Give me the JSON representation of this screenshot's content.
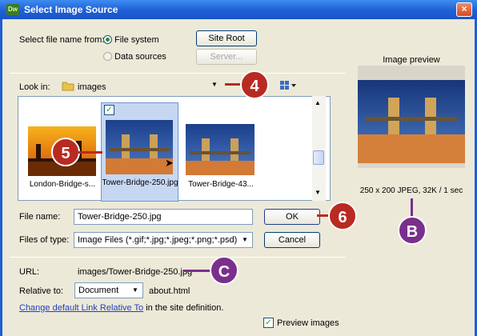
{
  "window": {
    "title": "Select Image Source",
    "app_icon": "Dw",
    "close_label": "×"
  },
  "select_from": {
    "label": "Select file name from:",
    "options": [
      {
        "label": "File system",
        "selected": true
      },
      {
        "label": "Data sources",
        "selected": false
      }
    ],
    "site_root_label": "Site Root",
    "server_label": "Server..."
  },
  "look_in": {
    "label": "Look in:",
    "value": "images",
    "view_icon": "thumbnails-view-icon"
  },
  "files": [
    {
      "name": "London-Bridge-s...",
      "selected": false
    },
    {
      "name": "Tower-Bridge-250.jpg",
      "selected": true
    },
    {
      "name": "Tower-Bridge-43...",
      "selected": false
    }
  ],
  "file_name": {
    "label": "File name:",
    "value": "Tower-Bridge-250.jpg",
    "ok_label": "OK"
  },
  "files_of_type": {
    "label": "Files of type:",
    "value": "Image Files (*.gif;*.jpg;*.jpeg;*.png;*.psd)",
    "cancel_label": "Cancel"
  },
  "url": {
    "label": "URL:",
    "value": "images/Tower-Bridge-250.jpg"
  },
  "relative_to": {
    "label": "Relative to:",
    "value": "Document",
    "file": "about.html"
  },
  "change_link": {
    "link_text": "Change default Link Relative To",
    "suffix": " in the site definition."
  },
  "preview_images": {
    "label": "Preview images",
    "checked": true
  },
  "preview": {
    "title": "Image preview",
    "info": "250 x 200 JPEG, 32K / 1 sec"
  },
  "callouts": {
    "c4": "4",
    "c5": "5",
    "c6": "6",
    "cB": "B",
    "cC": "C"
  },
  "colors": {
    "red_callout": "#b82a22",
    "purple_callout": "#7a2f8c",
    "titlebar": "#1f5fd6"
  }
}
